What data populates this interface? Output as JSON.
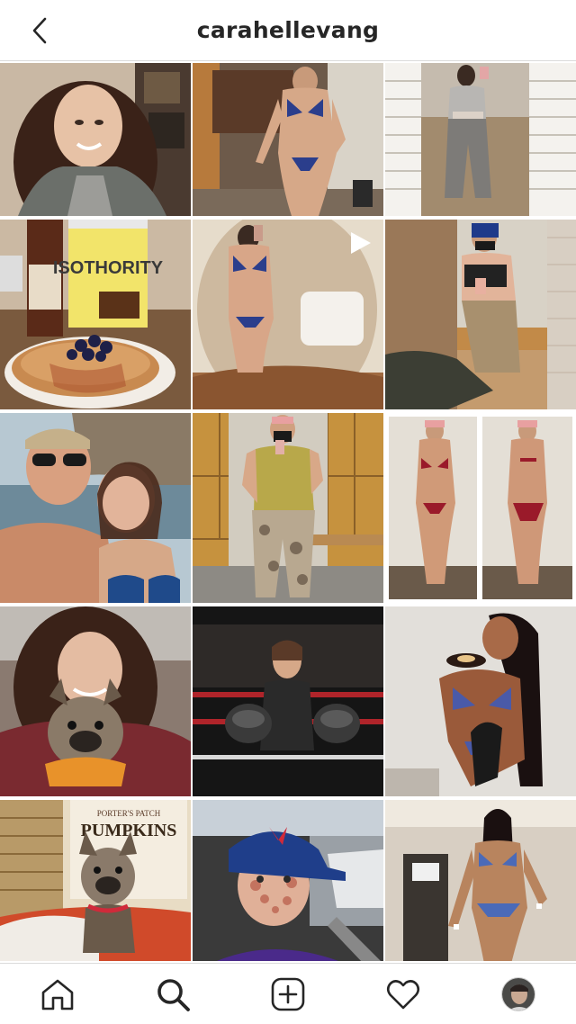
{
  "header": {
    "title": "carahellevang",
    "back_icon": "chevron-left-icon"
  },
  "grid": {
    "tiles": [
      {
        "subject": "smiling woman with long brown hair",
        "bg": "#8b7a6b"
      },
      {
        "subject": "woman posing in blue bikini indoors",
        "bg": "#6d5a4a"
      },
      {
        "subject": "mirror selfie woman in grey outfit",
        "bg": "#b8b2a8"
      },
      {
        "subject": "pancake syrup, Isothority protein tub and pancakes",
        "bg": "#6a4a3a"
      },
      {
        "subject": "mirror selfie in blue bikini",
        "bg": "#cdb99f",
        "reel": true
      },
      {
        "subject": "gym mirror selfie in camo leggings",
        "bg": "#8a6a50"
      },
      {
        "subject": "couple selfie by a lake",
        "bg": "#7d8e9b"
      },
      {
        "subject": "gym locker room selfie in camo leggings",
        "bg": "#b58642"
      },
      {
        "subject": "two photos posing in red bikini",
        "bg": "#cfc7bd"
      },
      {
        "subject": "woman holding french bulldog puppy",
        "bg": "#5a3a3a"
      },
      {
        "subject": "woman in boxing ring with gloves",
        "bg": "#222222"
      },
      {
        "subject": "competitor in blue bikini eating donut",
        "bg": "#e0ddd8"
      },
      {
        "subject": "french bulldog on pumpkins bag",
        "bg": "#b07a4a",
        "label": "PUMPKINS",
        "sublabel": "PORTER'S PATCH"
      },
      {
        "subject": "woman in blue cap in car",
        "bg": "#5a6a7a"
      },
      {
        "subject": "competitor posing in blue bikini in hallway",
        "bg": "#d8cfc3"
      }
    ]
  },
  "tabbar": {
    "items": [
      {
        "name": "home-icon",
        "label": "Home"
      },
      {
        "name": "search-icon",
        "label": "Search"
      },
      {
        "name": "add-post-icon",
        "label": "New post"
      },
      {
        "name": "heart-icon",
        "label": "Activity"
      },
      {
        "name": "profile-avatar",
        "label": "Profile"
      }
    ]
  },
  "colors": {
    "text": "#262626",
    "divider": "#dbdbdb",
    "background": "#ffffff"
  }
}
